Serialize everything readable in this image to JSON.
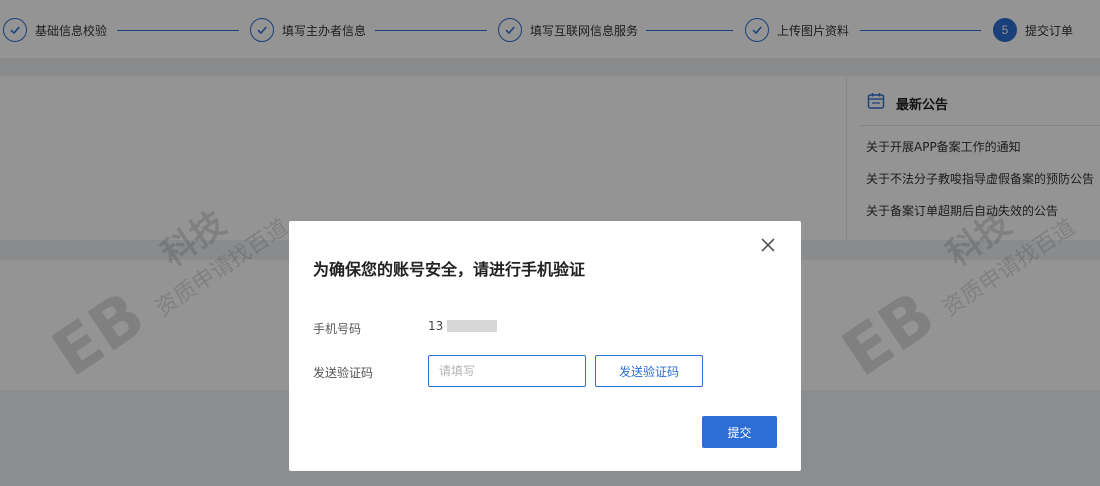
{
  "steps": [
    {
      "label": "基础信息校验",
      "status": "done",
      "icon": "check-icon"
    },
    {
      "label": "填写主办者信息",
      "status": "done",
      "icon": "check-icon"
    },
    {
      "label": "填写互联网信息服务",
      "status": "done",
      "icon": "check-icon"
    },
    {
      "label": "上传图片资料",
      "status": "done",
      "icon": "check-icon"
    },
    {
      "label": "提交订单",
      "status": "active",
      "number": "5"
    }
  ],
  "notice": {
    "icon": "calendar-icon",
    "title": "最新公告",
    "items": [
      "关于开展APP备案工作的通知",
      "关于不法分子教唆指导虚假备案的预防公告",
      "关于备案订单超期后自动失效的公告"
    ]
  },
  "watermark": {
    "main": "科技",
    "sub": "资质申请找百道"
  },
  "modal": {
    "title": "为确保您的账号安全，请进行手机验证",
    "close_icon": "close-icon",
    "phone_label": "手机号码",
    "phone_value": "13",
    "code_label": "发送验证码",
    "code_placeholder": "请填写",
    "send_button": "发送验证码",
    "submit_button": "提交"
  },
  "colors": {
    "primary": "#2c6ed5",
    "overlay": "rgba(0,0,0,0.42)"
  }
}
